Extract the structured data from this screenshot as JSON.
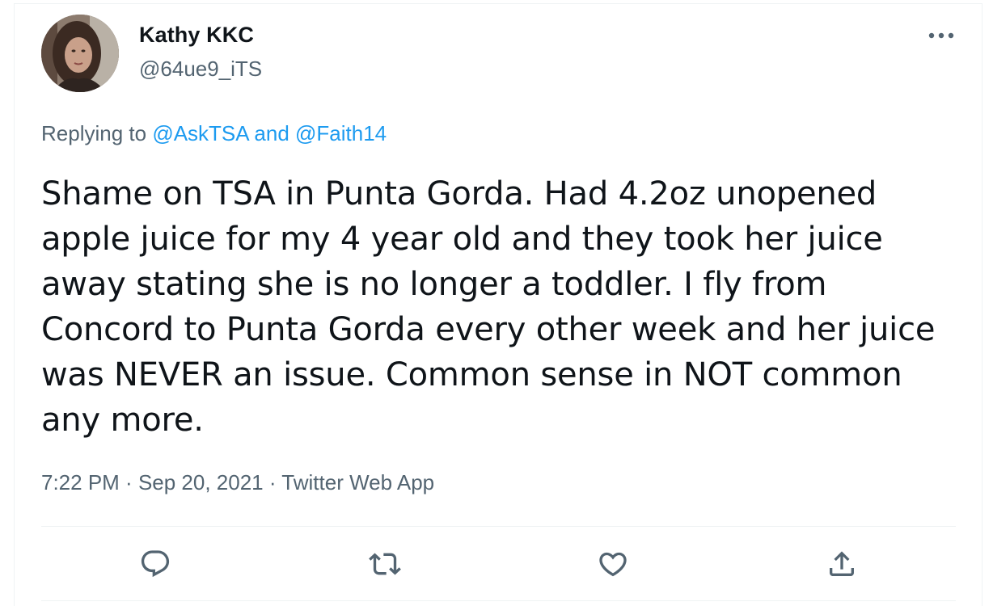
{
  "tweet": {
    "author": {
      "display_name": "Kathy KKC",
      "handle": "@64ue9_iTS"
    },
    "replying": {
      "prefix": "Replying to ",
      "mention_1": "@AskTSA",
      "joiner": " and ",
      "mention_2": "@Faith14"
    },
    "text": "Shame on TSA in Punta Gorda. Had 4.2oz unopened apple juice for my 4 year old and they took her juice away stating she is no longer a toddler. I fly from Concord to Punta Gorda every other week and her juice was NEVER an issue. Common sense in NOT common any more.",
    "time": "7:22 PM",
    "separator": " · ",
    "date": "Sep 20, 2021",
    "source": "Twitter Web App"
  },
  "icons": {
    "more": "more-horizontal-icon",
    "reply": "reply-icon",
    "retweet": "retweet-icon",
    "like": "heart-icon",
    "share": "share-icon"
  },
  "colors": {
    "text_primary": "#0f1419",
    "text_secondary": "#536471",
    "link": "#1d9bf0",
    "divider": "#eff3f4"
  }
}
